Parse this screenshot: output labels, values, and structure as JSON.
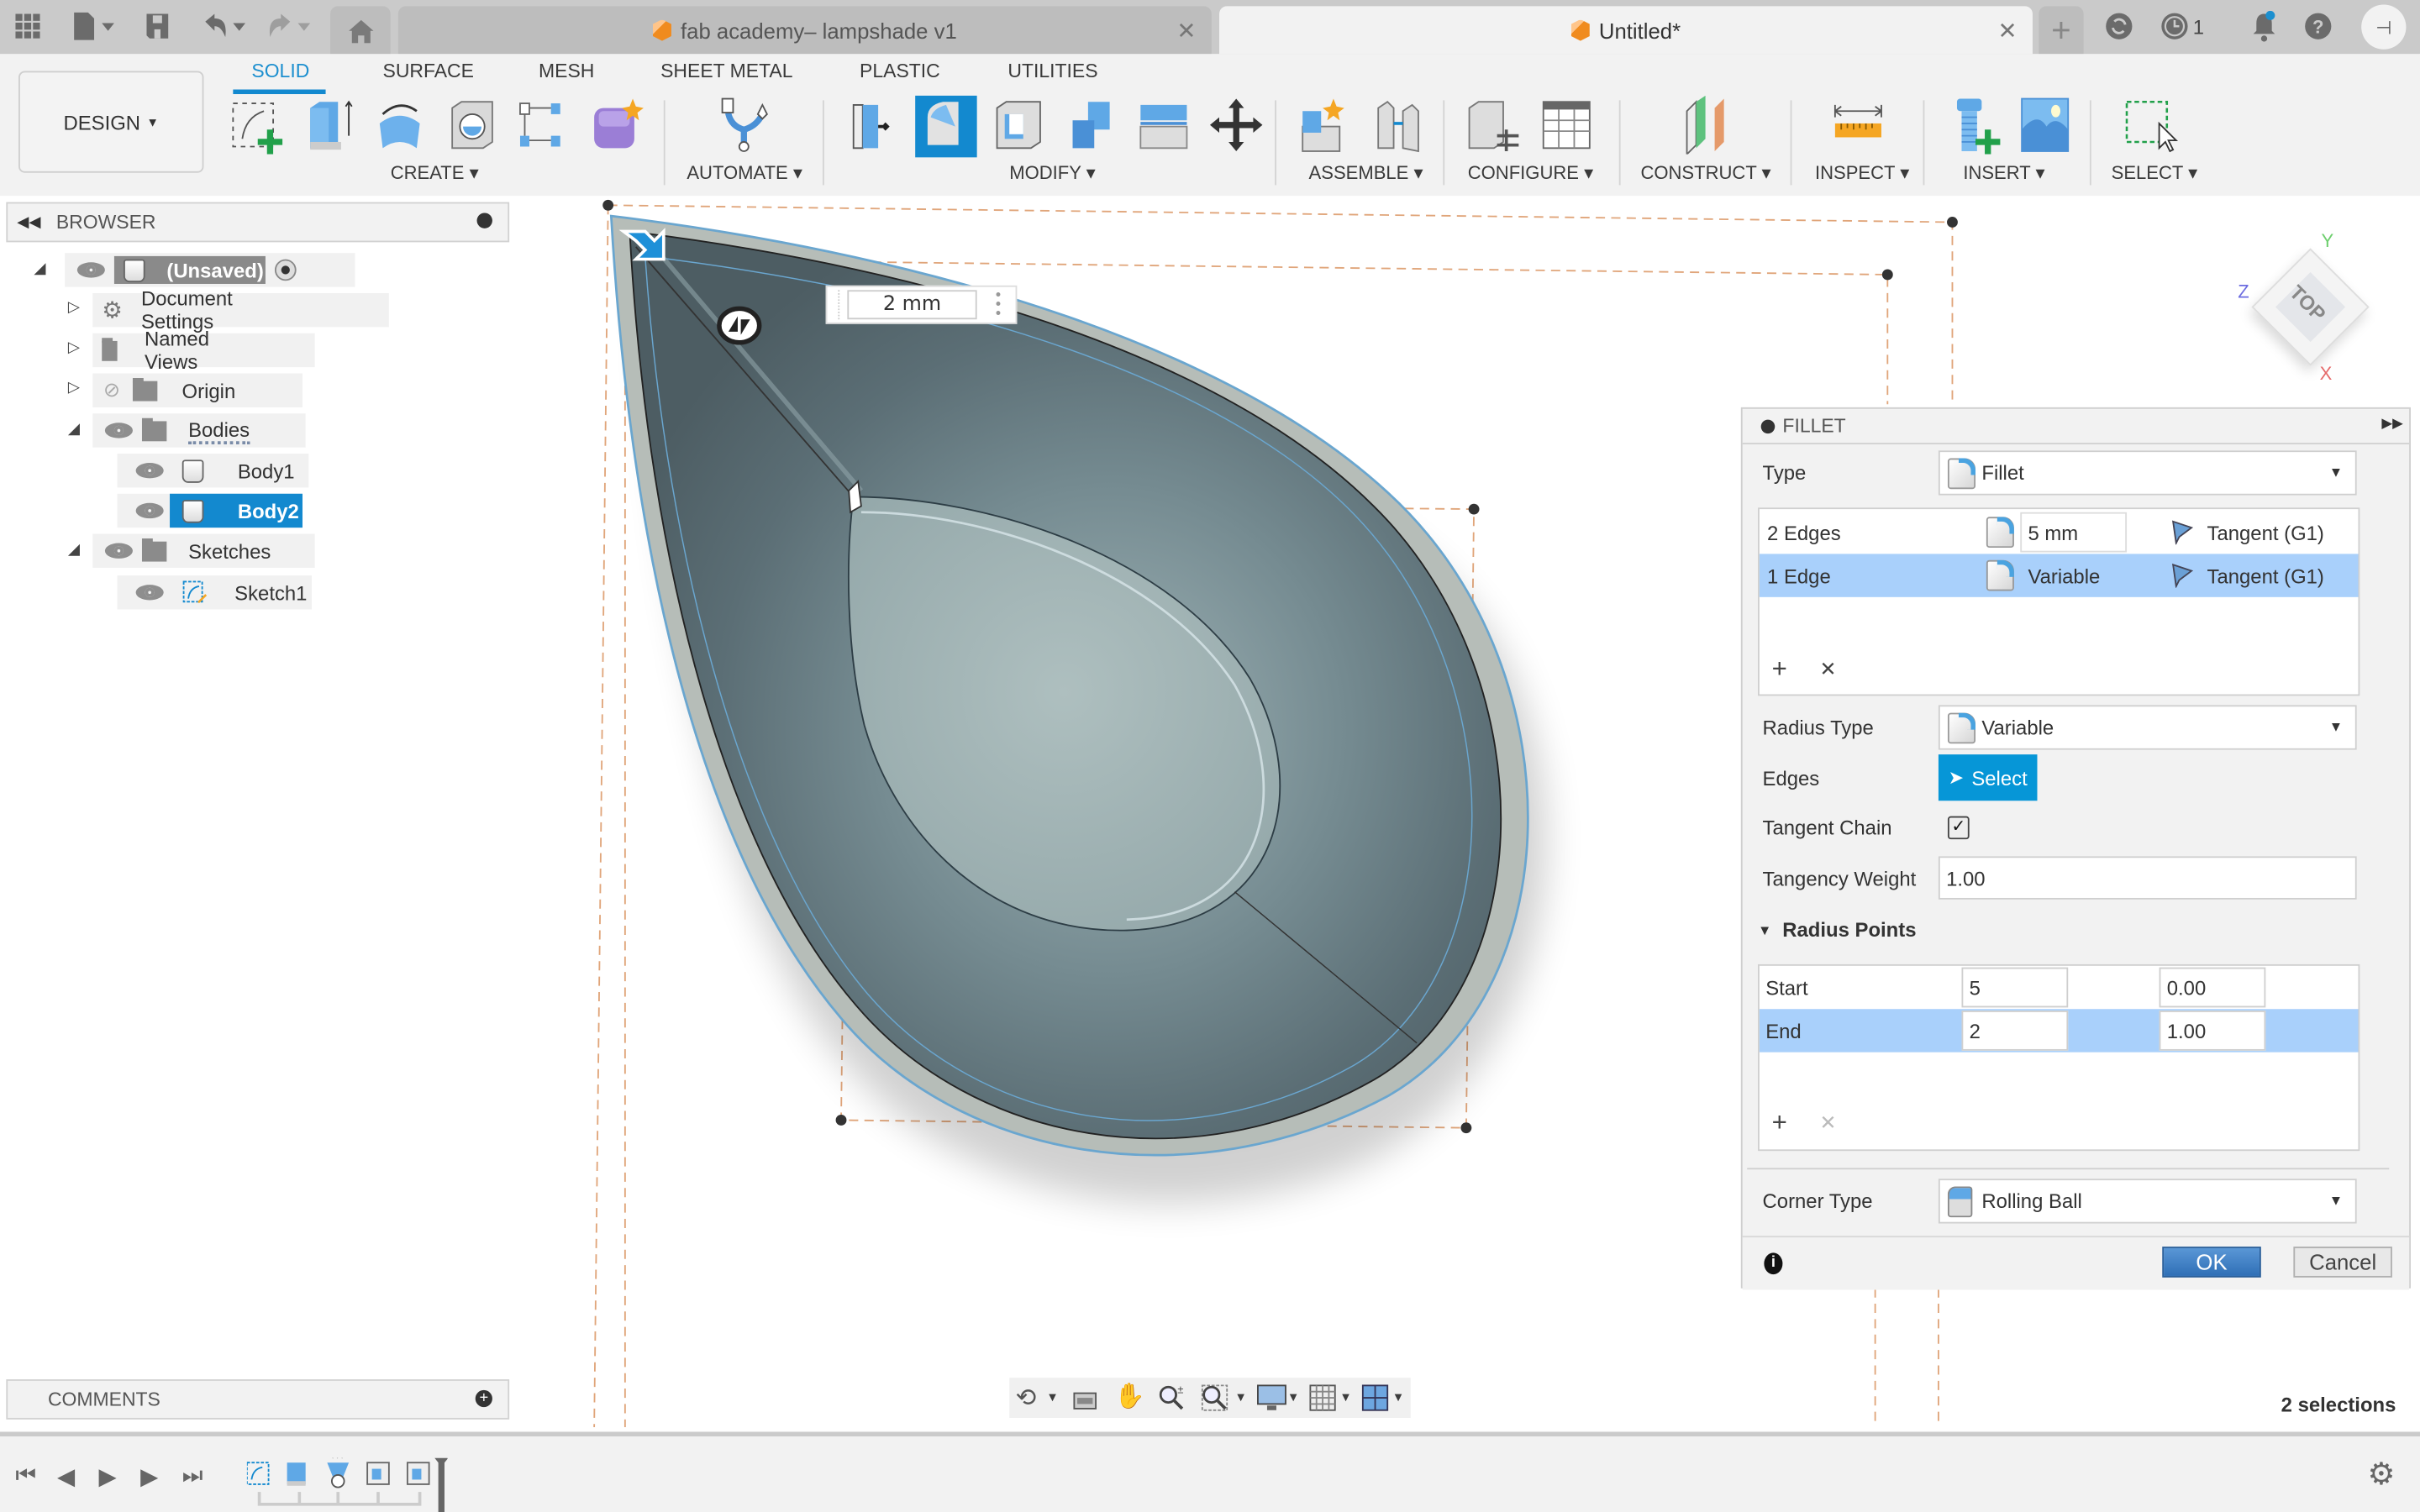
{
  "titlebar": {
    "tabs": [
      {
        "label": "fab academy– lampshade v1",
        "active": false
      },
      {
        "label": "Untitled*",
        "active": true
      }
    ],
    "job_count": "1"
  },
  "toolbar": {
    "workspace": "DESIGN",
    "workspace_tabs": [
      "SOLID",
      "SURFACE",
      "MESH",
      "SHEET METAL",
      "PLASTIC",
      "UTILITIES"
    ],
    "active_tab": "SOLID",
    "groups": [
      "CREATE",
      "AUTOMATE",
      "MODIFY",
      "ASSEMBLE",
      "CONFIGURE",
      "CONSTRUCT",
      "INSPECT",
      "INSERT",
      "SELECT"
    ]
  },
  "browser": {
    "title": "BROWSER",
    "items": [
      {
        "label": "(Unsaved)",
        "level": 0,
        "expanded": true
      },
      {
        "label": "Document Settings",
        "level": 1,
        "expanded": false
      },
      {
        "label": "Named Views",
        "level": 1,
        "expanded": false
      },
      {
        "label": "Origin",
        "level": 1,
        "expanded": false,
        "hidden": true
      },
      {
        "label": "Bodies",
        "level": 1,
        "expanded": true
      },
      {
        "label": "Body1",
        "level": 2
      },
      {
        "label": "Body2",
        "level": 2,
        "selected": true
      },
      {
        "label": "Sketches",
        "level": 1,
        "expanded": true
      },
      {
        "label": "Sketch1",
        "level": 2
      }
    ]
  },
  "comments": {
    "title": "COMMENTS"
  },
  "canvas": {
    "dimension_input": "2 mm",
    "viewcube": {
      "face": "TOP",
      "axes": [
        "X",
        "Y",
        "Z"
      ]
    }
  },
  "fillet": {
    "title": "FILLET",
    "type_label": "Type",
    "type_value": "Fillet",
    "edge_sets": [
      {
        "name": "2 Edges",
        "radius": "5 mm",
        "continuity": "Tangent (G1)",
        "selected": false
      },
      {
        "name": "1 Edge",
        "radius": "Variable",
        "continuity": "Tangent (G1)",
        "selected": true
      }
    ],
    "radius_type_label": "Radius Type",
    "radius_type_value": "Variable",
    "edges_label": "Edges",
    "select_button": "Select",
    "tangent_chain_label": "Tangent Chain",
    "tangent_chain_checked": true,
    "tangency_weight_label": "Tangency Weight",
    "tangency_weight_value": "1.00",
    "radius_points_label": "Radius Points",
    "radius_points": [
      {
        "name": "Start",
        "radius": "5",
        "position": "0.00",
        "selected": false
      },
      {
        "name": "End",
        "radius": "2",
        "position": "1.00",
        "selected": true
      }
    ],
    "corner_type_label": "Corner Type",
    "corner_type_value": "Rolling Ball",
    "ok_label": "OK",
    "cancel_label": "Cancel"
  },
  "status": {
    "selections": "2 selections"
  },
  "colors": {
    "accent": "#0696d7",
    "selection": "#a9d0fb",
    "ok_button": "#3b7dc4"
  }
}
